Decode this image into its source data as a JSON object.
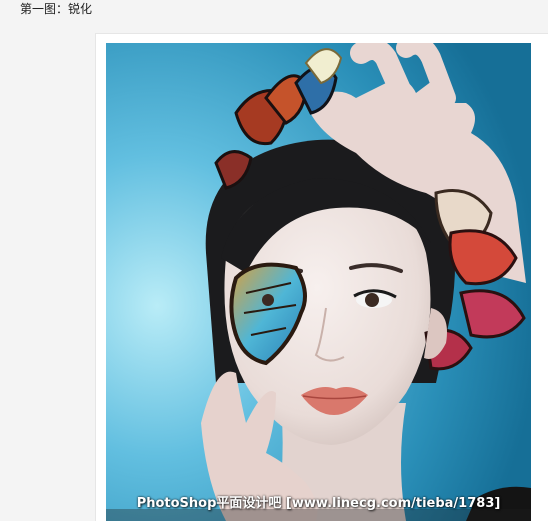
{
  "caption": "第一图：锐化",
  "image": {
    "subject": "woman with butterflies in hair and butterfly wing over eye",
    "watermark": "PhotoShop平面设计吧 [www.linecg.com/tieba/1783]"
  },
  "colors": {
    "page_background": "#f4f4f4",
    "frame_background": "#ffffff",
    "sky_light": "#8fd3ea",
    "sky_dark": "#1f7fa6",
    "skin": "#efe6e3",
    "hair": "#1b1b1d",
    "lips": "#d9786c"
  }
}
